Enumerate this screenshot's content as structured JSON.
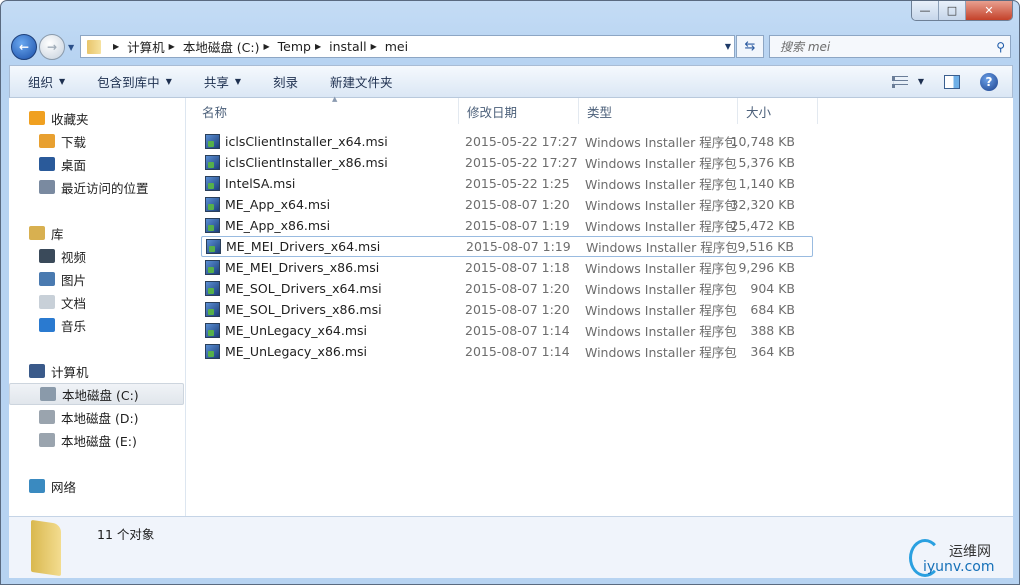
{
  "window": {
    "minimize": "—",
    "maximize": "□",
    "close": "✕"
  },
  "address": {
    "segments": [
      "计算机",
      "本地磁盘 (C:)",
      "Temp",
      "install",
      "mei"
    ]
  },
  "search": {
    "placeholder": "搜索 mei"
  },
  "toolbar": {
    "organize": "组织",
    "include_library": "包含到库中",
    "share": "共享",
    "burn": "刻录",
    "new_folder": "新建文件夹"
  },
  "sidebar": {
    "items": [
      {
        "label": "收藏夹",
        "level": 0,
        "icon": "star-icon",
        "color": "#f0a020"
      },
      {
        "label": "下载",
        "level": 1,
        "icon": "download-icon",
        "color": "#e8a030"
      },
      {
        "label": "桌面",
        "level": 1,
        "icon": "desktop-icon",
        "color": "#2a5a9a"
      },
      {
        "label": "最近访问的位置",
        "level": 1,
        "icon": "recent-places-icon",
        "color": "#7a8aa0"
      },
      {
        "label": "库",
        "level": 0,
        "icon": "library-icon",
        "color": "#d8b050"
      },
      {
        "label": "视频",
        "level": 1,
        "icon": "video-icon",
        "color": "#3a4a5a"
      },
      {
        "label": "图片",
        "level": 1,
        "icon": "pictures-icon",
        "color": "#4a7ab0"
      },
      {
        "label": "文档",
        "level": 1,
        "icon": "documents-icon",
        "color": "#c8d0d8"
      },
      {
        "label": "音乐",
        "level": 1,
        "icon": "music-icon",
        "color": "#2a7ad0"
      },
      {
        "label": "计算机",
        "level": 0,
        "icon": "computer-icon",
        "color": "#3a5a8a"
      },
      {
        "label": "本地磁盘 (C:)",
        "level": 1,
        "icon": "drive-icon",
        "color": "#8a9aaa",
        "selected": true
      },
      {
        "label": "本地磁盘 (D:)",
        "level": 1,
        "icon": "drive-icon",
        "color": "#9aa4ae"
      },
      {
        "label": "本地磁盘 (E:)",
        "level": 1,
        "icon": "drive-icon",
        "color": "#9aa4ae"
      },
      {
        "label": "网络",
        "level": 0,
        "icon": "network-icon",
        "color": "#3a8ac0"
      }
    ]
  },
  "columns": {
    "name": "名称",
    "date": "修改日期",
    "type": "类型",
    "size": "大小"
  },
  "files": [
    {
      "name": "iclsClientInstaller_x64.msi",
      "date": "2015-05-22 17:27",
      "type": "Windows Installer 程序包",
      "size": "10,748 KB"
    },
    {
      "name": "iclsClientInstaller_x86.msi",
      "date": "2015-05-22 17:27",
      "type": "Windows Installer 程序包",
      "size": "5,376 KB"
    },
    {
      "name": "IntelSA.msi",
      "date": "2015-05-22 1:25",
      "type": "Windows Installer 程序包",
      "size": "1,140 KB"
    },
    {
      "name": "ME_App_x64.msi",
      "date": "2015-08-07 1:20",
      "type": "Windows Installer 程序包",
      "size": "32,320 KB"
    },
    {
      "name": "ME_App_x86.msi",
      "date": "2015-08-07 1:19",
      "type": "Windows Installer 程序包",
      "size": "25,472 KB"
    },
    {
      "name": "ME_MEI_Drivers_x64.msi",
      "date": "2015-08-07 1:19",
      "type": "Windows Installer 程序包",
      "size": "9,516 KB",
      "focused": true
    },
    {
      "name": "ME_MEI_Drivers_x86.msi",
      "date": "2015-08-07 1:18",
      "type": "Windows Installer 程序包",
      "size": "9,296 KB"
    },
    {
      "name": "ME_SOL_Drivers_x64.msi",
      "date": "2015-08-07 1:20",
      "type": "Windows Installer 程序包",
      "size": "904 KB"
    },
    {
      "name": "ME_SOL_Drivers_x86.msi",
      "date": "2015-08-07 1:20",
      "type": "Windows Installer 程序包",
      "size": "684 KB"
    },
    {
      "name": "ME_UnLegacy_x64.msi",
      "date": "2015-08-07 1:14",
      "type": "Windows Installer 程序包",
      "size": "388 KB"
    },
    {
      "name": "ME_UnLegacy_x86.msi",
      "date": "2015-08-07 1:14",
      "type": "Windows Installer 程序包",
      "size": "364 KB"
    }
  ],
  "status": {
    "count": "11 个对象"
  },
  "watermark": {
    "line1": "运维网",
    "line2": "iyunv.com"
  }
}
